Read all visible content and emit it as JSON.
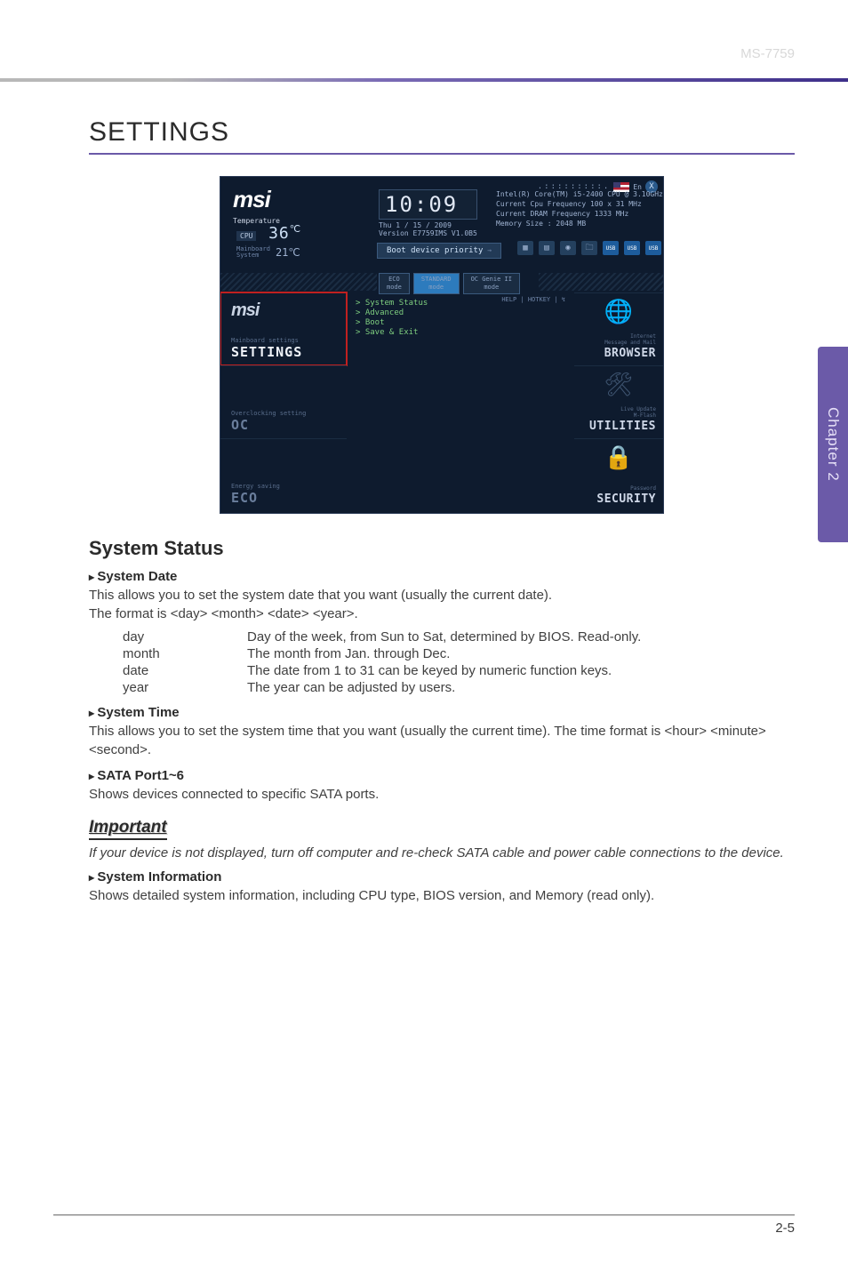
{
  "header": {
    "model": "MS-7759"
  },
  "sidetab": {
    "label": "Chapter 2"
  },
  "title": "SETTINGS",
  "shot": {
    "topbar": {
      "lang_dots": ".:::::::::.",
      "flag_code": "En",
      "close": "X"
    },
    "logo": "msi",
    "temp_label": "Temperature",
    "cpu": {
      "label": "CPU",
      "value": "36",
      "unit": "℃"
    },
    "mb": {
      "label1": "Mainboard",
      "label2": "System",
      "value": "21℃"
    },
    "clock": {
      "time": "10:09",
      "date": "Thu  1 / 15 / 2009",
      "version": "Version E7759IMS V1.0B5"
    },
    "boot_btn": "Boot device priority",
    "sysinfo": {
      "l1": "Intel(R) Core(TM) i5-2400 CPU @ 3.10GHz",
      "l2": "Current Cpu Frequency 100 x 31 MHz",
      "l3": "Current DRAM Frequency 1333 MHz",
      "l4": "Memory Size : 2048 MB"
    },
    "mode_tabs": [
      {
        "t": "ECO",
        "s": "mode"
      },
      {
        "t": "STANDARD",
        "s": "mode"
      },
      {
        "t": "OC Genie II",
        "s": "mode"
      }
    ],
    "left": {
      "settings": {
        "icon": "msi",
        "sub": "Mainboard settings",
        "big": "SETTINGS"
      },
      "oc": {
        "sub": "Overclocking setting",
        "big": "OC"
      },
      "eco": {
        "sub": "Energy saving",
        "big": "ECO"
      }
    },
    "right": {
      "browser": {
        "sub1": "Internet",
        "sub2": "Message and Mail",
        "big": "BROWSER"
      },
      "utilities": {
        "sub1": "Live Update",
        "sub2": "M-Flash",
        "big": "UTILITIES"
      },
      "security": {
        "sub1": "Password",
        "big": "SECURITY"
      }
    },
    "mid": {
      "help": "HELP | HOTKEY | ↯",
      "items": [
        "System Status",
        "Advanced",
        "Boot",
        "Save & Exit"
      ]
    }
  },
  "section1": {
    "heading": "System Status",
    "item1": {
      "title": "System Date",
      "p1": "This allows you to set the system date that you want (usually the current date).",
      "p2": "The format is <day> <month> <date> <year>.",
      "rows": [
        {
          "k": "day",
          "v": "Day of the week, from Sun to Sat, determined by BIOS. Read-only."
        },
        {
          "k": "month",
          "v": "The month from Jan. through Dec."
        },
        {
          "k": "date",
          "v": "The date from 1 to 31 can be keyed by numeric function keys."
        },
        {
          "k": "year",
          "v": "The year can be adjusted by users."
        }
      ]
    },
    "item2": {
      "title": "System Time",
      "p": "This allows you to set the system time that you want (usually the current time). The time format is <hour> <minute> <second>."
    },
    "item3": {
      "title": "SATA Port1~6",
      "p": "Shows devices connected to specific SATA ports."
    },
    "important": {
      "label": "Important",
      "body": "If your device is not displayed, turn off computer and re-check SATA cable and power cable connections to the device."
    },
    "item4": {
      "title": "System Information",
      "p": "Shows detailed system information, including CPU type, BIOS version, and Memory (read only)."
    }
  },
  "footer": {
    "page": "2-5"
  }
}
